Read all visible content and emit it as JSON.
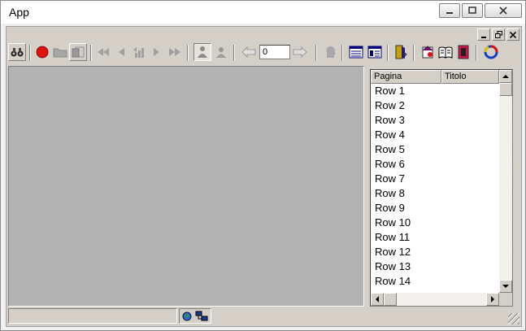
{
  "window": {
    "title": "App",
    "controls": [
      "minimize-icon",
      "maximize-icon",
      "close-icon"
    ]
  },
  "child_window": {
    "controls": [
      "minimize-icon",
      "restore-icon",
      "close-icon"
    ]
  },
  "toolbar": {
    "page_value": "0",
    "icons": [
      "binoculars-icon",
      "record-icon",
      "folder-icon",
      "document-icon",
      "first-icon",
      "previous-icon",
      "jump-icon",
      "next-icon",
      "last-icon",
      "person-icon",
      "person-alt-icon",
      "back-arrow-icon",
      "forward-arrow-icon",
      "head-icon",
      "list-view-icon",
      "detail-view-icon",
      "exit-icon",
      "bookmark-icon",
      "book-icon",
      "binder-icon",
      "refresh-icon"
    ]
  },
  "list": {
    "columns": [
      "Pagina",
      "Titolo"
    ],
    "rows": [
      "Row 1",
      "Row 2",
      "Row 3",
      "Row 4",
      "Row 5",
      "Row 6",
      "Row 7",
      "Row 8",
      "Row 9",
      "Row 10",
      "Row 11",
      "Row 12",
      "Row 13",
      "Row 14"
    ]
  },
  "status": {
    "text": "",
    "icons": [
      "globe-icon",
      "network-icon"
    ]
  },
  "colors": {
    "canvas": "#b3b3b3",
    "face": "#d4d0c8",
    "accent_red": "#e01010"
  }
}
